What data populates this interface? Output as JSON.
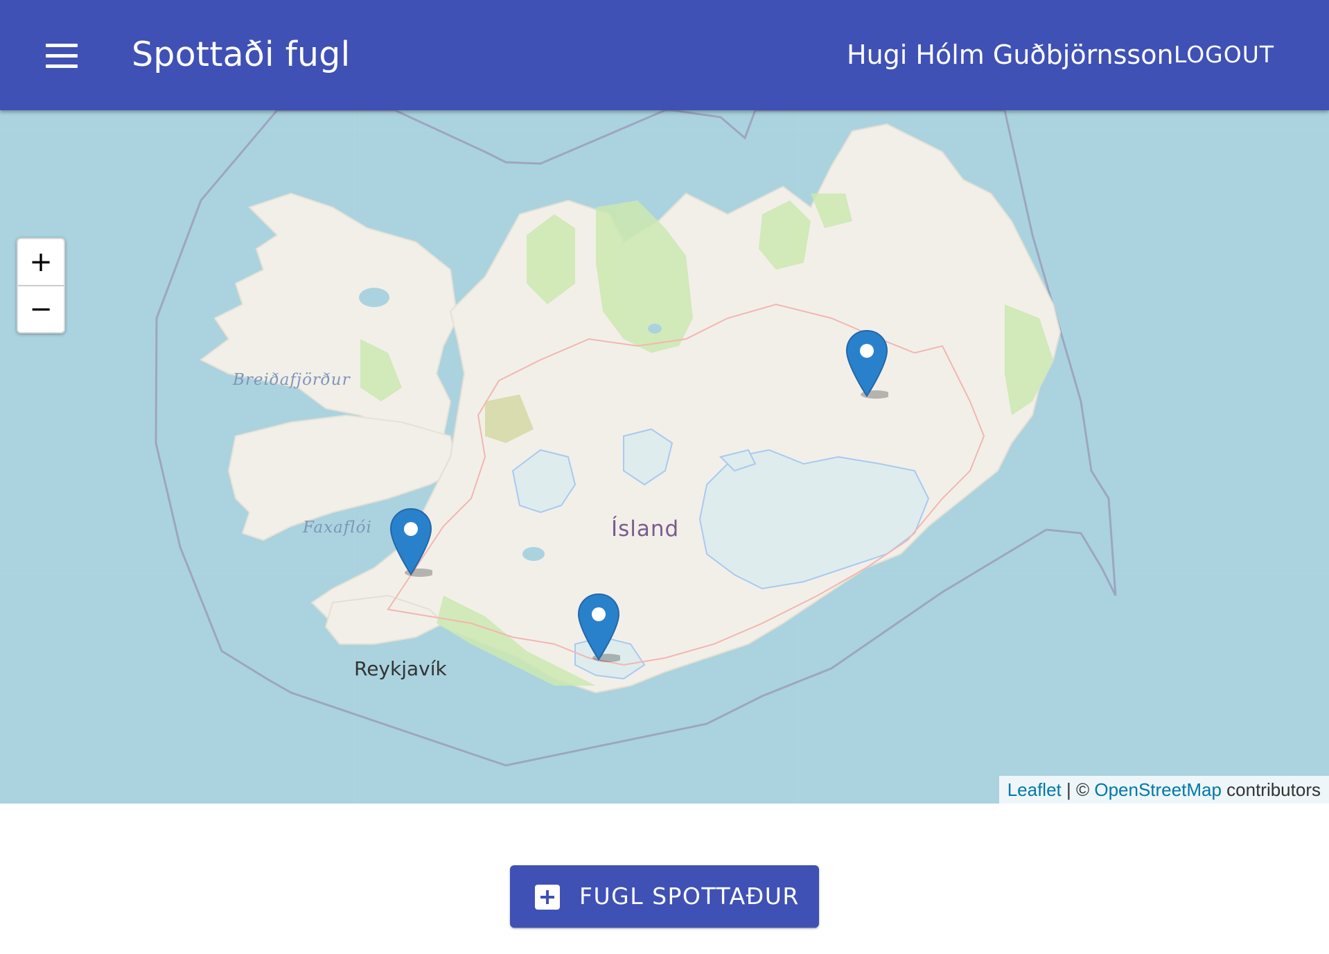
{
  "appbar": {
    "menu_icon": "hamburger-menu-icon",
    "title": "Spottaði fugl",
    "user_name": "Hugi Hólm Guðbjörnsson",
    "logout_label": "LOGOUT",
    "background": "#3f51b5"
  },
  "map": {
    "zoom_in_label": "+",
    "zoom_out_label": "−",
    "country_label": "Ísland",
    "labels": {
      "breidafjordur": "Breiðafjörður",
      "faxafloi": "Faxaflói",
      "reykjavik": "Reykjavík"
    },
    "marker_icon": "map-pin-icon",
    "marker_color": "#2a81cb",
    "water_color": "#aad3df",
    "land_color": "#f2efe9",
    "attribution": {
      "leaflet": "Leaflet",
      "separator": " | © ",
      "osm": "OpenStreetMap",
      "contributors": " contributors"
    }
  },
  "action": {
    "icon": "add-box-icon",
    "label": "FUGL SPOTTAÐUR"
  }
}
